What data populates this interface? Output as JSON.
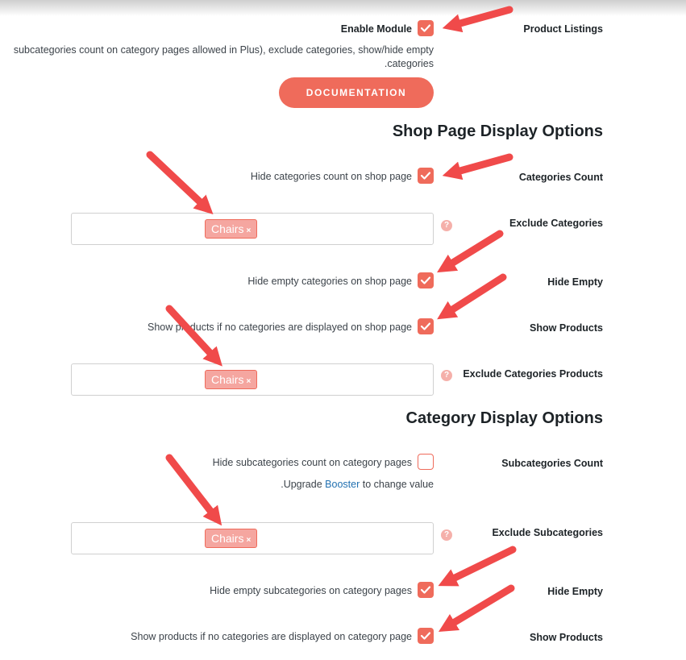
{
  "module": {
    "label": "Product Listings",
    "enable_label": "Enable Module",
    "enabled": true,
    "description_line1": "subcategories count on category pages allowed in Plus), exclude categories, show/hide empty",
    "description_line2": ".categories",
    "documentation_button": "DOCUMENTATION"
  },
  "shop": {
    "heading": "Shop Page Display Options",
    "categories_count": {
      "label": "Categories Count",
      "desc": "Hide categories count on shop page",
      "checked": true
    },
    "exclude_categories": {
      "label": "Exclude Categories",
      "tag": "Chairs",
      "remove": "×",
      "help": "?"
    },
    "hide_empty": {
      "label": "Hide Empty",
      "desc": "Hide empty categories on shop page",
      "checked": true
    },
    "show_products": {
      "label": "Show Products",
      "desc": "Show products if no categories are displayed on shop page",
      "checked": true
    },
    "exclude_products": {
      "label": "Exclude Categories Products",
      "tag": "Chairs",
      "remove": "×",
      "help": "?"
    }
  },
  "category": {
    "heading": "Category Display Options",
    "subcategories_count": {
      "label": "Subcategories Count",
      "desc": "Hide subcategories count on category pages",
      "checked": false,
      "upgrade_prefix": ".Upgrade",
      "upgrade_link": "Booster",
      "upgrade_suffix": "to change value"
    },
    "exclude_subcategories": {
      "label": "Exclude Subcategories",
      "tag": "Chairs",
      "remove": "×",
      "help": "?"
    },
    "hide_empty": {
      "label": "Hide Empty",
      "desc": "Hide empty subcategories on category pages",
      "checked": true
    },
    "show_products": {
      "label": "Show Products",
      "desc": "Show products if no categories are displayed on category page",
      "checked": true
    }
  },
  "colors": {
    "accent": "#ef6b5b",
    "arrow": "#f04a4a",
    "tag_bg": "#f5a6a0",
    "link": "#2271b1"
  }
}
